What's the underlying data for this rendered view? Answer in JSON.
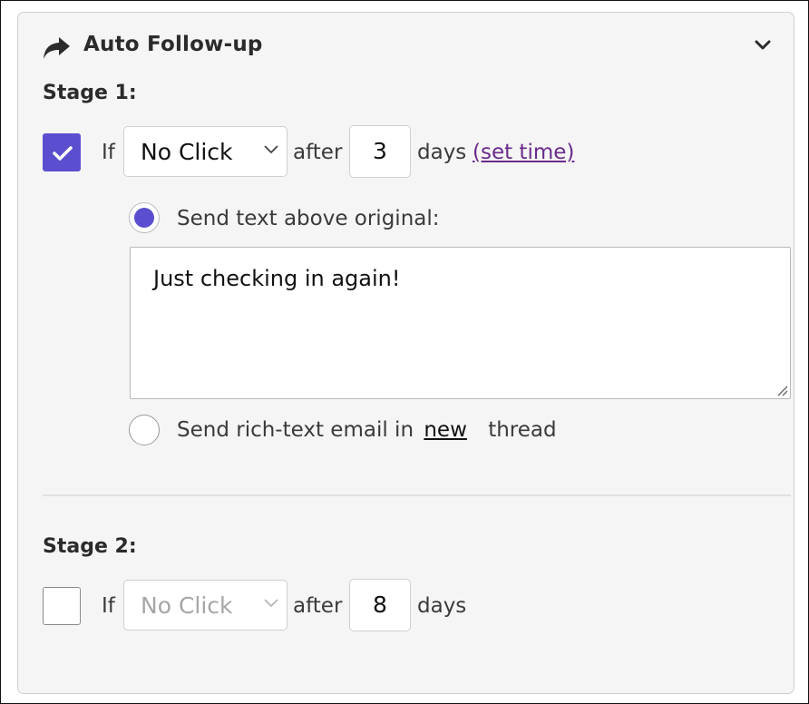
{
  "header": {
    "title": "Auto Follow-up",
    "icon": "share-forward-icon",
    "collapse_icon": "chevron-down-icon"
  },
  "stage1": {
    "label": "Stage 1:",
    "enabled": true,
    "if_label": "If",
    "condition": "No Click",
    "after_label": "after",
    "days_value": "3",
    "days_label": "days",
    "set_time_link": "(set time)",
    "option_text_above": "Send text above original:",
    "message": "Just checking in again!",
    "option_rich_prefix": "Send rich-text email in",
    "option_rich_new": "new",
    "option_rich_suffix": "thread"
  },
  "stage2": {
    "label": "Stage 2:",
    "enabled": false,
    "if_label": "If",
    "condition": "No Click",
    "after_label": "after",
    "days_value": "8",
    "days_label": "days"
  },
  "colors": {
    "accent": "#5b4fcf",
    "link": "#6a2a8c",
    "panel_bg": "#f5f5f5"
  }
}
